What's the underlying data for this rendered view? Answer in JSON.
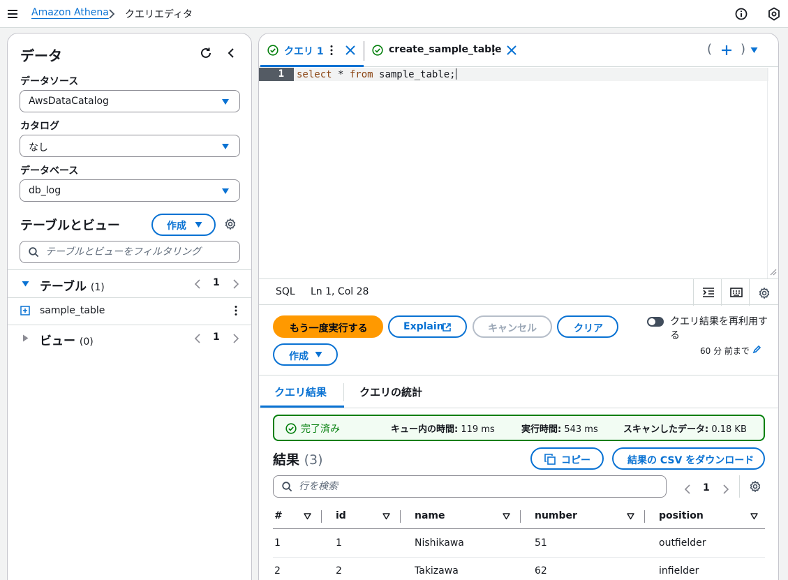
{
  "topbar": {
    "breadcrumb_link": "Amazon Athena",
    "breadcrumb_current": "クエリエディタ"
  },
  "left": {
    "title": "データ",
    "datasource_label": "データソース",
    "datasource_value": "AwsDataCatalog",
    "catalog_label": "カタログ",
    "catalog_value": "なし",
    "database_label": "データベース",
    "database_value": "db_log",
    "tables_views_title": "テーブルとビュー",
    "create_label": "作成",
    "filter_placeholder": "テーブルとビューをフィルタリング",
    "tables_section": {
      "label": "テーブル",
      "count": "(1)",
      "page": "1"
    },
    "table_items": [
      "sample_table"
    ],
    "views_section": {
      "label": "ビュー",
      "count": "(0)",
      "page": "1"
    }
  },
  "editor": {
    "tabs": [
      {
        "label": "クエリ 1",
        "status": "success"
      },
      {
        "label": "create_sample_table",
        "status": "success"
      }
    ],
    "line_number": "1",
    "code": {
      "kw1": "select",
      "mid": " * ",
      "kw2": "from",
      "rest": " sample_table;"
    },
    "language": "SQL",
    "cursor_position": "Ln 1, Col 28",
    "paren_open": "(",
    "paren_close": ")"
  },
  "actions": {
    "run_again": "もう一度実行する",
    "explain": "Explain",
    "cancel": "キャンセル",
    "clear": "クリア",
    "create": "作成",
    "reuse_label": "クエリ結果を再利用する",
    "reuse_sub": "60 分 前まで"
  },
  "result_tabs": {
    "results": "クエリ結果",
    "stats": "クエリの統計"
  },
  "status": {
    "state": "完了済み",
    "queue_label": "キュー内の時間:",
    "queue_value": "119 ms",
    "exec_label": "実行時間:",
    "exec_value": "543 ms",
    "scan_label": "スキャンしたデータ:",
    "scan_value": "0.18 KB"
  },
  "results": {
    "title": "結果",
    "count": "(3)",
    "copy": "コピー",
    "download_csv": "結果の CSV をダウンロード",
    "search_placeholder": "行を検索",
    "page": "1",
    "columns": [
      "#",
      "id",
      "name",
      "number",
      "position"
    ],
    "rows": [
      [
        "1",
        "1",
        "Nishikawa",
        "51",
        "outfielder"
      ],
      [
        "2",
        "2",
        "Takizawa",
        "62",
        "infielder"
      ]
    ]
  },
  "colors": {
    "accent": "#0972d3",
    "primary_button": "#ff9900",
    "success": "#037f0c"
  }
}
